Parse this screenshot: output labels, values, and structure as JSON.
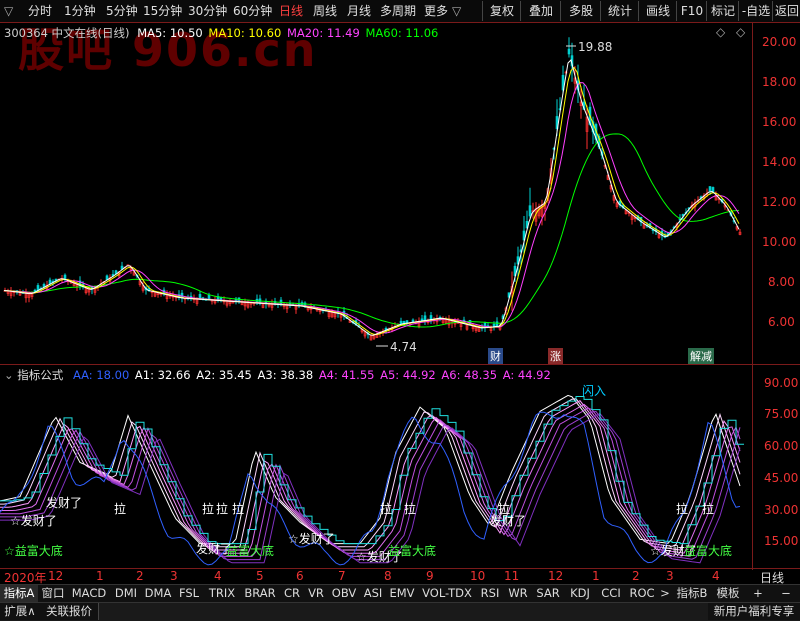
{
  "toolbar": {
    "dropdown_glyph": "▽",
    "tabs": [
      "分时",
      "1分钟",
      "5分钟",
      "15分钟",
      "30分钟",
      "60分钟",
      "日线",
      "周线",
      "月线",
      "多周期",
      "更多"
    ],
    "active_tab": "日线",
    "right_buttons": [
      "复权",
      "叠加",
      "多股",
      "统计",
      "画线",
      "F10",
      "标记",
      "-自选",
      "返回"
    ]
  },
  "watermark": "股吧 906.cn",
  "main_header": {
    "code_name": "300364 中文在线(日线)",
    "ma5": "MA5: 10.50",
    "ma10": "MA10: 10.60",
    "ma20": "MA20: 11.49",
    "ma60": "MA60: 11.06",
    "diamond": "◇",
    "square": "◇"
  },
  "price_axis": [
    "20.00",
    "18.00",
    "16.00",
    "14.00",
    "12.00",
    "10.00",
    "8.00",
    "6.00"
  ],
  "price_labels": {
    "high": "19.88",
    "low": "4.74"
  },
  "event_marks": {
    "cai": "财",
    "zhang": "涨",
    "jiejian": "解减"
  },
  "indicator_header": {
    "name": "指标公式",
    "aa": "AA: 18.00",
    "a1": "A1: 32.66",
    "a2": "A2: 35.45",
    "a3": "A3: 38.38",
    "a4": "A4: 41.55",
    "a5": "A5: 44.92",
    "a6": "A6: 48.35",
    "a": "A: 44.92"
  },
  "indicator_axis": [
    "90.00",
    "75.00",
    "60.00",
    "45.00",
    "30.00",
    "15.00"
  ],
  "annotations": {
    "fa_cai": "发财了",
    "la": "拉",
    "yi_fu": "☆益富大底",
    "shan_ru": "闪入",
    "fa_cai_full": "☆发财了",
    "fu_di": "益富大底"
  },
  "time_axis": {
    "labels": [
      "2020年",
      "12",
      "1",
      "2",
      "3",
      "4",
      "5",
      "6",
      "7",
      "8",
      "9",
      "10",
      "11",
      "12",
      "1",
      "2",
      "3",
      "4"
    ],
    "period": "日线"
  },
  "indicator_tabs": [
    "指标A",
    "窗口",
    "MACD",
    "DMI",
    "DMA",
    "FSL",
    "TRIX",
    "BRAR",
    "CR",
    "VR",
    "OBV",
    "ASI",
    "EMV",
    "VOL-TDX",
    "RSI",
    "WR",
    "SAR",
    "KDJ",
    "CCI",
    "ROC",
    ">",
    "指标B",
    "模板",
    "+",
    "−"
  ],
  "bottom_bar": {
    "expand": "扩展∧",
    "related": "关联报价",
    "promo": "新用户福利专享"
  },
  "colors": {
    "up": "#ff3030",
    "down": "#00d0d0",
    "ma5": "#ffffff",
    "ma10": "#ffff00",
    "ma20": "#ff40ff",
    "ma60": "#00ff00",
    "axis": "#ff3030",
    "aa": "#3060ff"
  }
}
